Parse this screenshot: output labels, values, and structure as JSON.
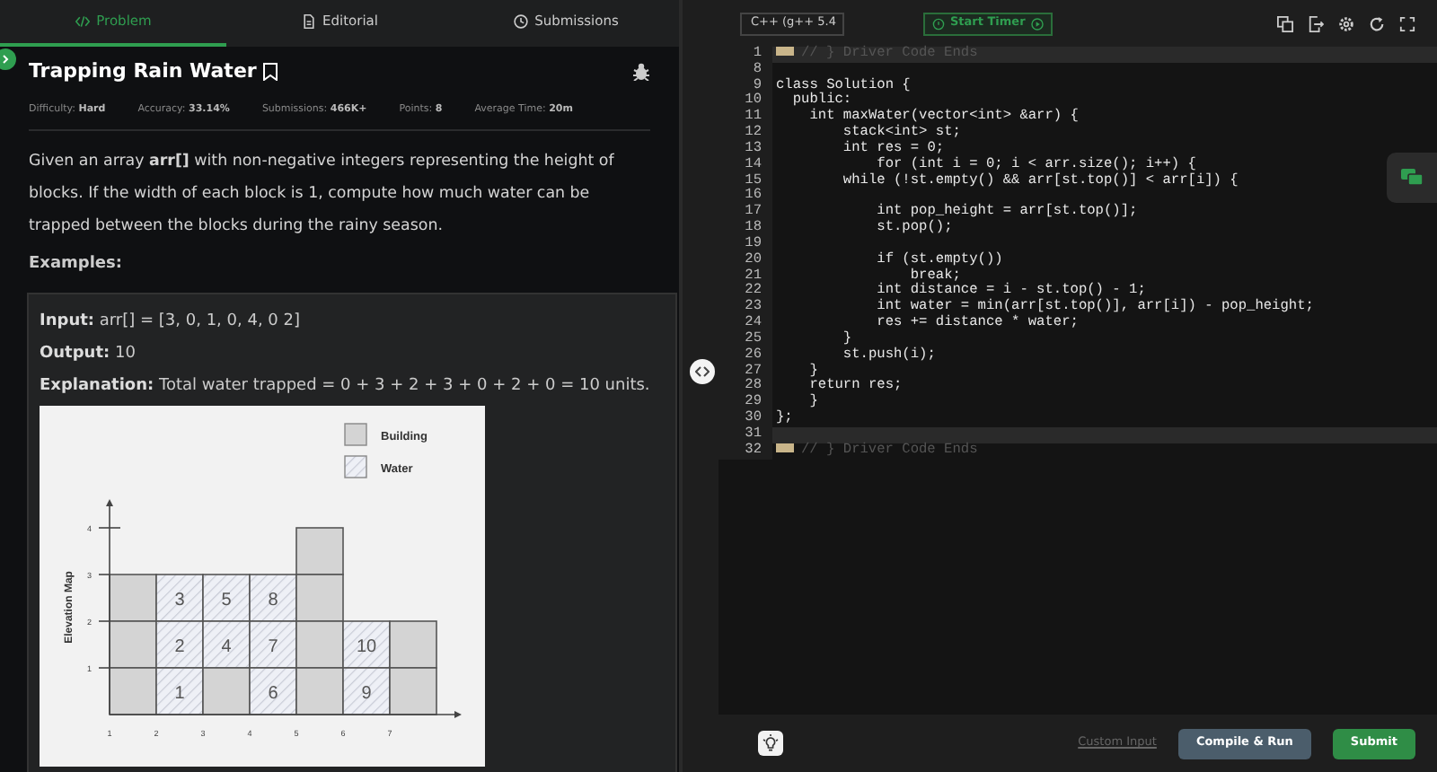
{
  "left_tabs": [
    {
      "label": "Problem",
      "kind": "code",
      "selected": true
    },
    {
      "label": "Editorial",
      "kind": "doc",
      "selected": false
    },
    {
      "label": "Submissions",
      "kind": "clock",
      "selected": false
    }
  ],
  "problem": {
    "title": "Trapping Rain Water",
    "meta": [
      "Difficulty: **Hard**",
      "Accuracy: **33.14%**",
      "Submissions: **466K+**",
      "Points: **8**",
      "Average Time: **20m**"
    ],
    "description": "Given an array **arr[]** with non-negative integers representing the height of blocks. If the width of each block is 1, compute how much water can be trapped between the blocks during the rainy season.",
    "examples_heading": "Examples:",
    "example": [
      {
        "label": "Input:",
        "value": "arr[] = [3, 0, 1, 0, 4, 0 2]"
      },
      {
        "label": "Output:",
        "value": "10"
      },
      {
        "label": "Explanation:",
        "value": "Total water trapped = 0 + 3 + 2 + 3 + 0 + 2 + 0 = 10 units."
      }
    ],
    "figure": {
      "legend": [
        {
          "label": "Building",
          "kind": "building"
        },
        {
          "label": "Water",
          "kind": "water"
        }
      ],
      "axis_label": "Elevation Map",
      "y_ticks": [
        "4",
        "3",
        "2",
        "1"
      ],
      "x_ticks": [
        "1",
        "2",
        "3",
        "4",
        "5",
        "6",
        "7"
      ],
      "columns": [
        {
          "blocks": [
            {
              "kind": "building"
            },
            {
              "kind": "building"
            },
            {
              "kind": "building"
            }
          ]
        },
        {
          "blocks": [
            {
              "kind": "water",
              "label": "3"
            },
            {
              "kind": "water",
              "label": "2"
            },
            {
              "kind": "water",
              "label": "1"
            }
          ]
        },
        {
          "blocks": [
            {
              "kind": "water",
              "label": "5"
            },
            {
              "kind": "water",
              "label": "4"
            },
            {
              "kind": "building"
            }
          ]
        },
        {
          "blocks": [
            {
              "kind": "water",
              "label": "8"
            },
            {
              "kind": "water",
              "label": "7"
            },
            {
              "kind": "water",
              "label": "6"
            }
          ]
        },
        {
          "blocks": [
            {
              "kind": "building"
            },
            {
              "kind": "building"
            },
            {
              "kind": "building"
            },
            {
              "kind": "building"
            }
          ]
        },
        {
          "blocks": [
            {
              "kind": "water",
              "label": "10"
            },
            {
              "kind": "water",
              "label": "9"
            }
          ]
        },
        {
          "blocks": [
            {
              "kind": "building"
            },
            {
              "kind": "building"
            }
          ]
        }
      ]
    }
  },
  "editor": {
    "language": "C++ (g++ 5.4",
    "timer": "Start Timer",
    "lines": [
      {
        "number": "1",
        "text": "// } Driver Code Ends",
        "kind": "folded",
        "highlighted": true
      },
      {
        "number": "8",
        "kind": "code",
        "highlighted": false
      },
      {
        "number": "9",
        "text": "class Solution {",
        "kind": "code",
        "highlighted": false
      },
      {
        "number": "10",
        "text": "  public:",
        "kind": "code",
        "highlighted": false
      },
      {
        "number": "11",
        "text": "    int maxWater(vector<int> &arr) {",
        "kind": "code",
        "highlighted": false
      },
      {
        "number": "12",
        "text": "        stack<int> st;",
        "kind": "code",
        "highlighted": false
      },
      {
        "number": "13",
        "text": "        int res = 0;",
        "kind": "code",
        "highlighted": false
      },
      {
        "number": "14",
        "text": "            for (int i = 0; i < arr.size(); i++) {",
        "kind": "code",
        "highlighted": false
      },
      {
        "number": "15",
        "text": "        while (!st.empty() && arr[st.top()] < arr[i]) {",
        "kind": "code",
        "highlighted": false
      },
      {
        "number": "16",
        "kind": "code",
        "highlighted": false
      },
      {
        "number": "17",
        "text": "            int pop_height = arr[st.top()];",
        "kind": "code",
        "highlighted": false
      },
      {
        "number": "18",
        "text": "            st.pop();",
        "kind": "code",
        "highlighted": false
      },
      {
        "number": "19",
        "kind": "code",
        "highlighted": false
      },
      {
        "number": "20",
        "text": "            if (st.empty())",
        "kind": "code",
        "highlighted": false
      },
      {
        "number": "21",
        "text": "                break;",
        "kind": "code",
        "highlighted": false
      },
      {
        "number": "22",
        "text": "            int distance = i - st.top() - 1;",
        "kind": "code",
        "highlighted": false
      },
      {
        "number": "23",
        "text": "            int water = min(arr[st.top()], arr[i]) - pop_height;",
        "kind": "code",
        "highlighted": false
      },
      {
        "number": "24",
        "text": "            res += distance * water;",
        "kind": "code",
        "highlighted": false
      },
      {
        "number": "25",
        "text": "        }",
        "kind": "code",
        "highlighted": false
      },
      {
        "number": "26",
        "text": "        st.push(i);",
        "kind": "code",
        "highlighted": false
      },
      {
        "number": "27",
        "text": "    }",
        "kind": "code",
        "highlighted": false
      },
      {
        "number": "28",
        "text": "    return res;",
        "kind": "code",
        "highlighted": false
      },
      {
        "number": "29",
        "text": "    }",
        "kind": "code",
        "highlighted": false
      },
      {
        "number": "30",
        "text": "};",
        "kind": "code",
        "highlighted": false
      },
      {
        "number": "31",
        "kind": "code",
        "highlighted": true
      },
      {
        "number": "32",
        "text": "// } Driver Code Ends",
        "kind": "folded",
        "highlighted": false
      }
    ]
  },
  "footer": {
    "custom_input": "Custom Input",
    "compile": "Compile & Run",
    "submit": "Submit"
  }
}
